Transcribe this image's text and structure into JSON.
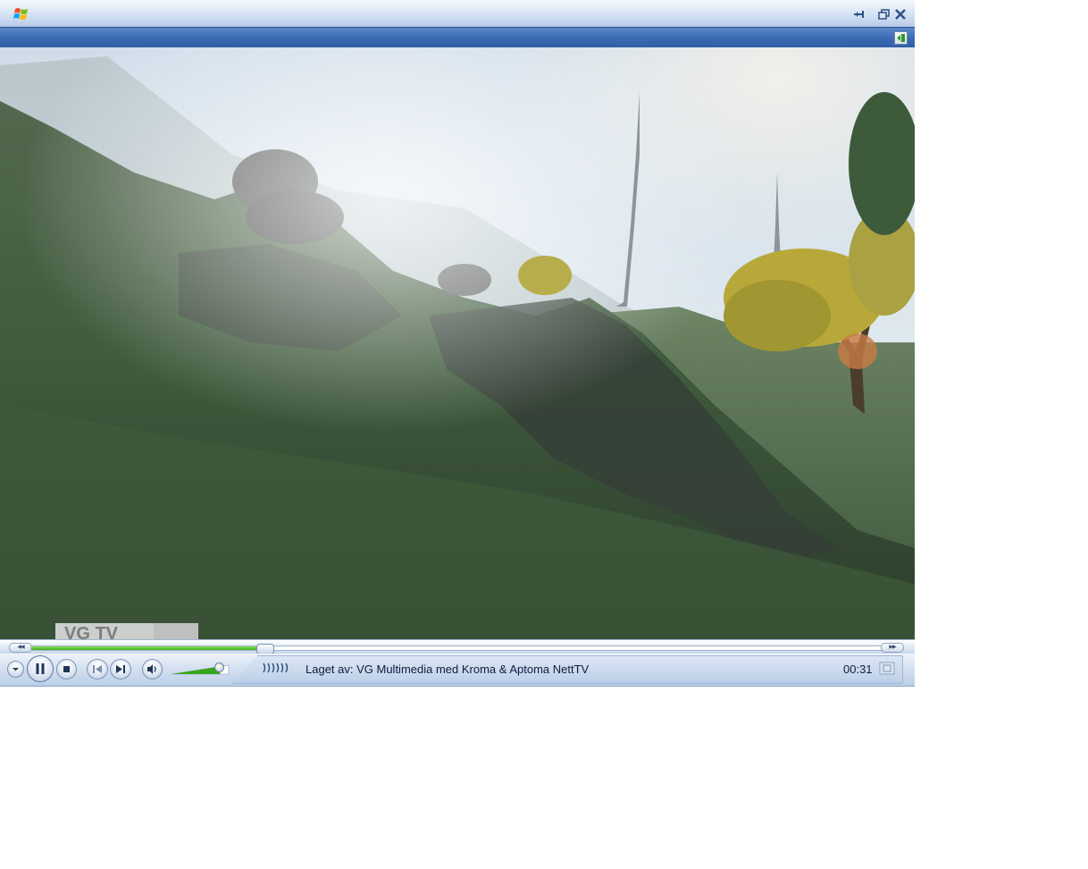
{
  "window": {
    "app_icon": "windows-logo-icon",
    "controls": [
      "minimode-icon",
      "restore-icon",
      "close-icon"
    ]
  },
  "menustrip": {
    "now_playing_icon": "now-playing-toggle-icon"
  },
  "video": {
    "watermark": "VG TV"
  },
  "playback": {
    "seek_progress": 0.27,
    "volume": 0.85,
    "state": "playing",
    "status_text": "Laget av: VG Multimedia med Kroma & Aptoma NettTV",
    "elapsed_time": "00:31"
  },
  "colors": {
    "seek_fill": "#3dae1a",
    "volume_fill": "#37a61a",
    "menustrip": "#3d6cb4"
  }
}
